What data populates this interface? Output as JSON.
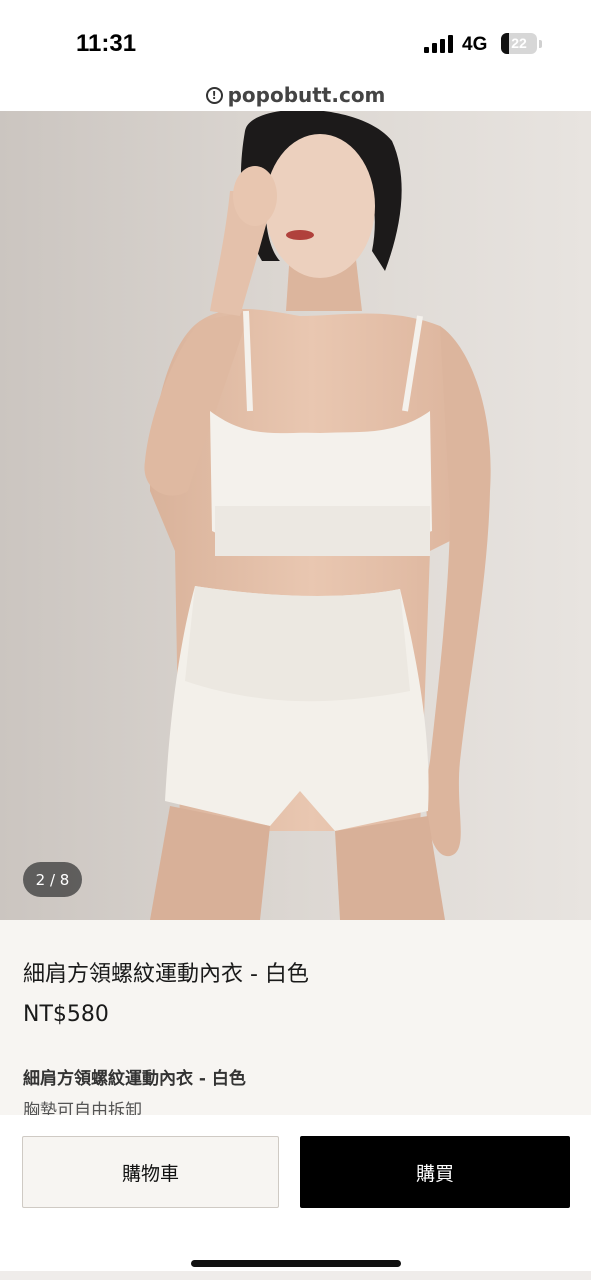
{
  "status_bar": {
    "time": "11:31",
    "network": "4G",
    "battery_level": "22",
    "battery_fraction": 0.22,
    "signal_icon": "signal-bars-icon"
  },
  "browser": {
    "url": "popobutt.com",
    "security_icon": "info-circle-icon"
  },
  "gallery": {
    "counter": "2 / 8",
    "image_description_icon": "product-photo"
  },
  "product": {
    "title": "細肩方領螺紋運動內衣 - 白色",
    "price": "NT$580",
    "description_title": "細肩方領螺紋運動內衣 - 白色",
    "description_line": "胸墊可自由拆卸"
  },
  "actions": {
    "cart_label": "購物車",
    "buy_label": "購買"
  },
  "colors": {
    "buy_button_bg": "#000000",
    "info_bg": "#f7f5f2",
    "cart_button_bg": "#f7f5f2"
  }
}
